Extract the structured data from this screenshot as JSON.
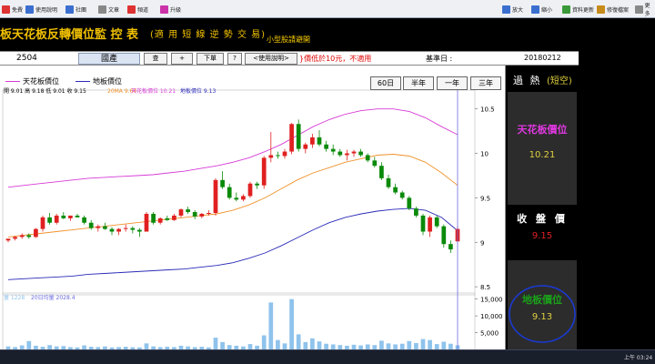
{
  "toolbar": {
    "left": [
      {
        "label": "免費",
        "icon": "home-icon",
        "color": "#d33"
      },
      {
        "label": "使用說明",
        "icon": "help-icon",
        "color": "#3a6fd0"
      },
      {
        "label": "社團",
        "icon": "group-icon",
        "color": "#3a6fd0"
      },
      {
        "label": "文章",
        "icon": "document-icon",
        "color": "#888"
      },
      {
        "label": "頻道",
        "icon": "video-icon",
        "color": "#d33"
      },
      {
        "label": "升級",
        "icon": "upgrade-icon",
        "color": "#c3a"
      }
    ],
    "right": [
      {
        "label": "放大",
        "icon": "zoom-in-icon",
        "color": "#3a6fd0"
      },
      {
        "label": "縮小",
        "icon": "zoom-out-icon",
        "color": "#3a6fd0"
      },
      {
        "label": "資料更新",
        "icon": "refresh-icon",
        "color": "#3a9a3a"
      },
      {
        "label": "修復檔案",
        "icon": "repair-icon",
        "color": "#c78b1a"
      },
      {
        "label": "更多",
        "icon": "more-icon",
        "color": "#888"
      }
    ]
  },
  "title": {
    "main": "板天花板反轉價位監 控 表",
    "sub": "(適 用 短 線 逆 勢 交 易)",
    "note": "小型股請避開"
  },
  "controls": {
    "code": "2504",
    "name": "國產",
    "buttons": [
      "查",
      "+",
      "下單",
      "?",
      "<使用說明>"
    ],
    "warning": "}價低於10元，不適用",
    "date_label": "基準日 :",
    "date": "20180212"
  },
  "legend": {
    "ceiling": "天花板價位",
    "floor": "地板價位"
  },
  "periods": [
    "60日",
    "半年",
    "一年",
    "三年"
  ],
  "price_info": {
    "text": "開 9.01  高 9.18  低 9.01  收 9.15",
    "ma": "20MA 9.64",
    "ceiling": "天花板價位 10.21",
    "floor": "地板價位 9.13"
  },
  "volume_info": {
    "vol": "量 1228",
    "avg": "20日均量 2028.4"
  },
  "panel": {
    "status_prefix": "過 熱",
    "status_suffix": "(短空)",
    "ceiling_label": "天花板價位",
    "ceiling_value": "10.21",
    "close_label": "收 盤 價",
    "close_value": "9.15",
    "floor_label": "地板價位",
    "floor_value": "9.13"
  },
  "taskbar": {
    "clock": "上午 03:24"
  },
  "chart_data": {
    "type": "line",
    "price_axis": {
      "ticks": [
        "10.5",
        "10",
        "9.5",
        "9",
        "8.5"
      ],
      "range": [
        8.45,
        10.65
      ]
    },
    "volume_axis": {
      "ticks": [
        "15,000",
        "10,000",
        "5,000"
      ],
      "range": [
        0,
        16000
      ]
    },
    "candles": [
      [
        9.02,
        9.04,
        9.0,
        9.04
      ],
      [
        9.04,
        9.07,
        9.02,
        9.06
      ],
      [
        9.06,
        9.1,
        9.04,
        9.08
      ],
      [
        9.08,
        9.1,
        9.04,
        9.06
      ],
      [
        9.06,
        9.16,
        9.05,
        9.15
      ],
      [
        9.15,
        9.3,
        9.12,
        9.28
      ],
      [
        9.28,
        9.33,
        9.2,
        9.22
      ],
      [
        9.22,
        9.32,
        9.2,
        9.3
      ],
      [
        9.3,
        9.34,
        9.26,
        9.27
      ],
      [
        9.27,
        9.3,
        9.24,
        9.3
      ],
      [
        9.3,
        9.32,
        9.28,
        9.28
      ],
      [
        9.28,
        9.3,
        9.2,
        9.22
      ],
      [
        9.22,
        9.25,
        9.14,
        9.16
      ],
      [
        9.16,
        9.2,
        9.12,
        9.18
      ],
      [
        9.18,
        9.22,
        9.14,
        9.15
      ],
      [
        9.15,
        9.17,
        9.08,
        9.12
      ],
      [
        9.12,
        9.16,
        9.08,
        9.15
      ],
      [
        9.15,
        9.2,
        9.12,
        9.16
      ],
      [
        9.16,
        9.18,
        9.1,
        9.14
      ],
      [
        9.14,
        9.16,
        9.06,
        9.12
      ],
      [
        9.12,
        9.34,
        9.12,
        9.32
      ],
      [
        9.32,
        9.34,
        9.2,
        9.22
      ],
      [
        9.22,
        9.28,
        9.2,
        9.27
      ],
      [
        9.27,
        9.3,
        9.24,
        9.25
      ],
      [
        9.25,
        9.32,
        9.24,
        9.3
      ],
      [
        9.3,
        9.38,
        9.28,
        9.37
      ],
      [
        9.37,
        9.4,
        9.32,
        9.34
      ],
      [
        9.34,
        9.36,
        9.26,
        9.29
      ],
      [
        9.29,
        9.33,
        9.27,
        9.32
      ],
      [
        9.32,
        9.36,
        9.3,
        9.33
      ],
      [
        9.33,
        9.72,
        9.3,
        9.7
      ],
      [
        9.7,
        9.8,
        9.6,
        9.62
      ],
      [
        9.62,
        9.66,
        9.48,
        9.5
      ],
      [
        9.5,
        9.56,
        9.46,
        9.48
      ],
      [
        9.48,
        9.54,
        9.46,
        9.52
      ],
      [
        9.52,
        9.68,
        9.5,
        9.66
      ],
      [
        9.66,
        9.68,
        9.6,
        9.64
      ],
      [
        9.64,
        9.97,
        9.6,
        9.95
      ],
      [
        9.95,
        10.24,
        9.9,
        9.98
      ],
      [
        9.98,
        10.02,
        9.94,
        9.97
      ],
      [
        9.97,
        10.05,
        9.94,
        10.02
      ],
      [
        10.02,
        10.34,
        9.99,
        10.33
      ],
      [
        10.33,
        10.38,
        10.02,
        10.05
      ],
      [
        10.05,
        10.12,
        10.0,
        10.1
      ],
      [
        10.1,
        10.22,
        10.06,
        10.18
      ],
      [
        10.18,
        10.26,
        10.08,
        10.1
      ],
      [
        10.1,
        10.14,
        10.02,
        10.05
      ],
      [
        10.05,
        10.1,
        9.98,
        10.02
      ],
      [
        10.02,
        10.05,
        9.96,
        9.98
      ],
      [
        9.98,
        10.04,
        9.92,
        10.0
      ],
      [
        10.0,
        10.04,
        9.96,
        10.02
      ],
      [
        10.02,
        10.05,
        9.96,
        9.98
      ],
      [
        9.98,
        10.0,
        9.9,
        9.92
      ],
      [
        9.92,
        9.96,
        9.84,
        9.86
      ],
      [
        9.86,
        9.9,
        9.7,
        9.72
      ],
      [
        9.72,
        9.76,
        9.6,
        9.62
      ],
      [
        9.62,
        9.66,
        9.54,
        9.56
      ],
      [
        9.56,
        9.58,
        9.48,
        9.5
      ],
      [
        9.5,
        9.52,
        9.36,
        9.38
      ],
      [
        9.38,
        9.4,
        9.28,
        9.3
      ],
      [
        9.3,
        9.32,
        9.08,
        9.12
      ],
      [
        9.12,
        9.3,
        9.06,
        9.28
      ],
      [
        9.28,
        9.3,
        9.16,
        9.18
      ],
      [
        9.18,
        9.2,
        8.94,
        8.98
      ],
      [
        8.98,
        9.02,
        8.88,
        8.92
      ],
      [
        9.01,
        9.18,
        9.01,
        9.15
      ]
    ],
    "ceiling_line": [
      9.62,
      9.64,
      9.66,
      9.68,
      9.7,
      9.72,
      9.73,
      9.74,
      9.75,
      9.76,
      9.78,
      9.8,
      9.83,
      9.86,
      9.9,
      9.95,
      10.02,
      10.1,
      10.2,
      10.3,
      10.38,
      10.44,
      10.48,
      10.5,
      10.5,
      10.47,
      10.4,
      10.3,
      10.21
    ],
    "ma20_line": [
      9.06,
      9.08,
      9.1,
      9.12,
      9.14,
      9.16,
      9.18,
      9.2,
      9.22,
      9.24,
      9.26,
      9.28,
      9.3,
      9.32,
      9.36,
      9.42,
      9.5,
      9.6,
      9.7,
      9.78,
      9.84,
      9.9,
      9.94,
      9.98,
      9.99,
      9.97,
      9.9,
      9.78,
      9.64
    ],
    "floor_line": [
      8.58,
      8.59,
      8.6,
      8.61,
      8.62,
      8.64,
      8.65,
      8.66,
      8.67,
      8.68,
      8.69,
      8.7,
      8.72,
      8.74,
      8.77,
      8.82,
      8.88,
      8.96,
      9.05,
      9.14,
      9.22,
      9.28,
      9.32,
      9.35,
      9.37,
      9.38,
      9.36,
      9.28,
      9.13
    ],
    "volume": [
      900,
      700,
      1200,
      2500,
      1100,
      800,
      1300,
      900,
      1000,
      700,
      600,
      1200,
      800,
      700,
      900,
      600,
      700,
      800,
      650,
      600,
      1800,
      900,
      700,
      800,
      700,
      1100,
      900,
      700,
      800,
      600,
      3500,
      2200,
      1300,
      1100,
      900,
      1600,
      1100,
      4200,
      14000,
      2800,
      1800,
      15000,
      4500,
      2200,
      3300,
      2400,
      1700,
      1500,
      1300,
      1100,
      1400,
      1200,
      1500,
      1300,
      2600,
      1800,
      1500,
      1700,
      2500,
      1900,
      3100,
      2800,
      1600,
      2300,
      1700,
      1228
    ]
  }
}
